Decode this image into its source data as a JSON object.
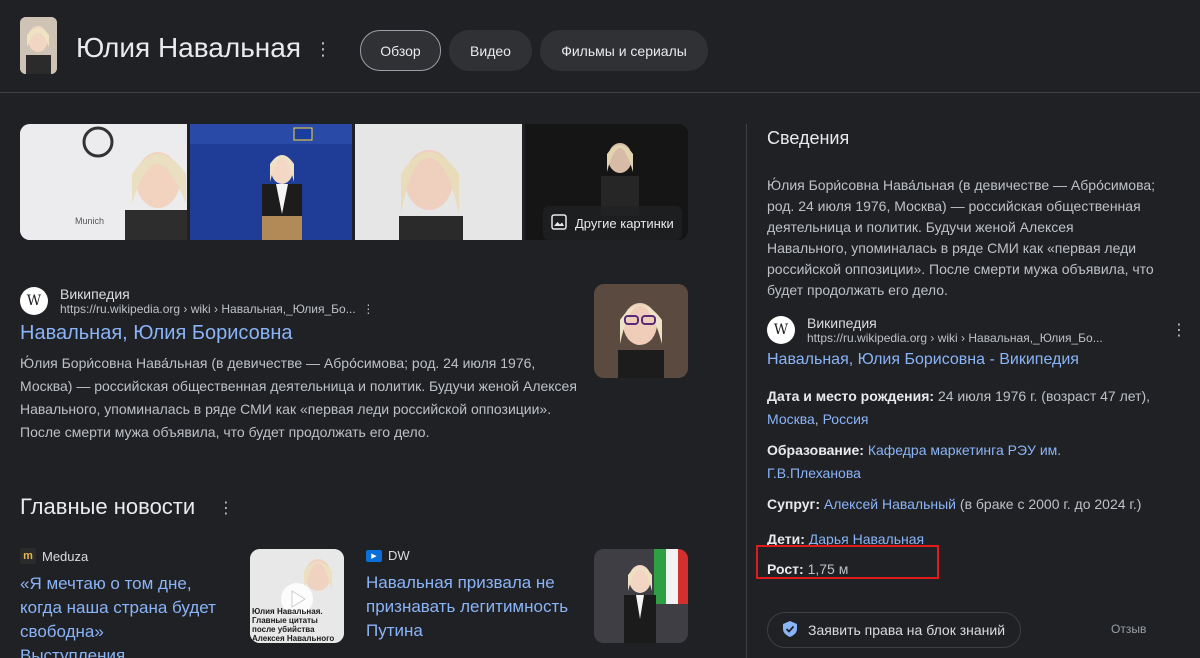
{
  "header": {
    "title": "Юлия Навальная",
    "tabs": [
      {
        "label": "Обзор",
        "active": true
      },
      {
        "label": "Видео",
        "active": false
      },
      {
        "label": "Фильмы и сериалы",
        "active": false
      }
    ]
  },
  "images": {
    "more_label": "Другие картинки"
  },
  "result": {
    "source_name": "Википедия",
    "url": "https://ru.wikipedia.org › wiki › Навальная,_Юлия_Бо...",
    "title": "Навальная, Юлия Борисовна",
    "snippet": "Ю́лия Бори́совна Нава́льная (в девичестве — Абро́симова; род. 24 июля 1976, Москва) — российская общественная деятельница и политик. Будучи женой Алексея Навального, упоминалась в ряде СМИ как «первая леди российской оппозиции». После смерти мужа объявила, что будет продолжать его дело."
  },
  "news": {
    "heading": "Главные новости",
    "items": [
      {
        "publisher": "Meduza",
        "headline": "«Я мечтаю о том дне, когда наша страна будет свободна» Выступления…",
        "thumb_caption": "Юлия Навальная. Главные цитаты после убийства Алексея Навального"
      },
      {
        "publisher": "DW",
        "headline": "Навальная призвала не признавать легитимность Путина"
      }
    ]
  },
  "knowledge_panel": {
    "heading": "Сведения",
    "description": "Ю́лия Бори́совна Нава́льная (в девичестве — Абро́симова; род. 24 июля 1976, Москва) — российская общественная деятельница и политик. Будучи женой Алексея Навального, упоминалась в ряде СМИ как «первая леди российской оппозиции». После смерти мужа объявила, что будет продолжать его дело.",
    "source_name": "Википедия",
    "source_url": "https://ru.wikipedia.org › wiki › Навальная,_Юлия_Бо...",
    "source_title": "Навальная, Юлия Борисовна - Википедия",
    "facts": {
      "birth_label": "Дата и место рождения:",
      "birth_text": "24 июля 1976 г. (возраст 47 лет),",
      "birth_link1": "Москва",
      "birth_link2": "Россия",
      "education_label": "Образование:",
      "education_link": "Кафедра маркетинга РЭУ им. Г.В.Плеханова",
      "spouse_label": "Супруг:",
      "spouse_link": "Алексей Навальный",
      "spouse_text": "(в браке с 2000 г. до 2024 г.)",
      "children_label": "Дети:",
      "children_link": "Дарья Навальная",
      "height_label": "Рост:",
      "height_value": "1,75 м"
    },
    "claim_label": "Заявить права на блок знаний",
    "feedback_label": "Отзыв"
  },
  "colors": {
    "background": "#202124",
    "link": "#8ab4f8",
    "highlight": "#e01b1b"
  }
}
